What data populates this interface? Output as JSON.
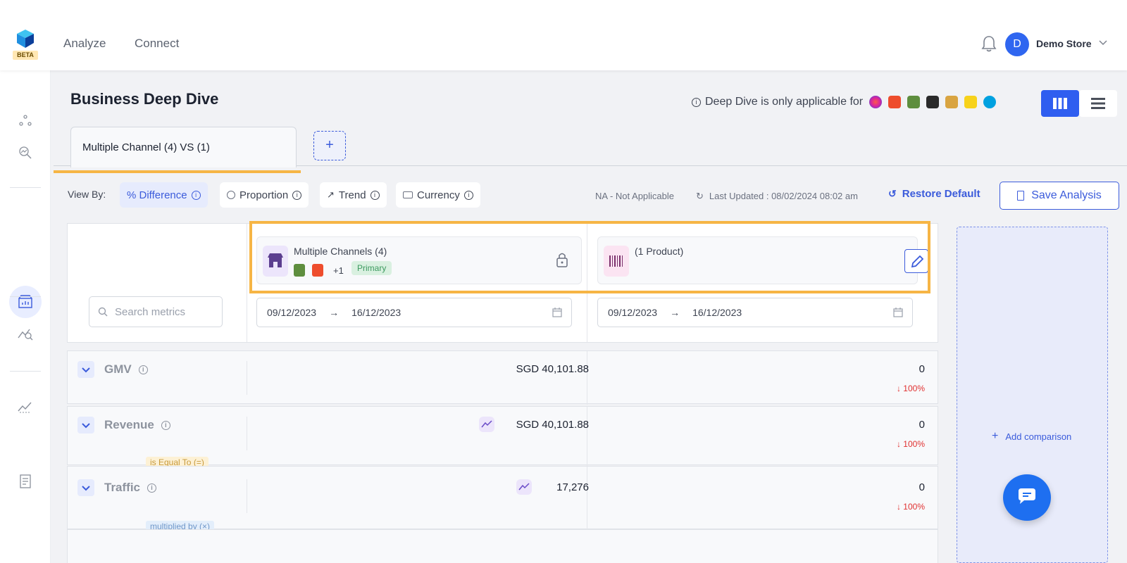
{
  "header": {
    "beta_label": "BETA",
    "nav": [
      "Analyze",
      "Connect"
    ],
    "avatar_initial": "D",
    "store_name": "Demo Store"
  },
  "page": {
    "title": "Business Deep Dive",
    "deep_dive_note": "Deep Dive is only applicable for",
    "channel_icons": [
      "instagram-ads-icon",
      "shopee-icon",
      "shopify-icon",
      "tiktok-icon",
      "marketplace-box-icon",
      "flipkart-icon",
      "salesforce-icon"
    ]
  },
  "tabs": {
    "active_label": "Multiple Channel (4) VS (1)",
    "add_label": "+"
  },
  "toolbar": {
    "view_by_label": "View By:",
    "options": [
      "% Difference",
      "Proportion",
      "Trend",
      "Currency"
    ],
    "na_note": "NA - Not Applicable",
    "last_updated": "Last Updated : 08/02/2024 08:02 am",
    "restore_label": "Restore Default",
    "save_label": "Save Analysis"
  },
  "search": {
    "placeholder": "Search metrics"
  },
  "columns": [
    {
      "name": "Multiple Channels (4)",
      "extra_count": "+1",
      "badge": "Primary",
      "date_from": "09/12/2023",
      "date_to": "16/12/2023"
    },
    {
      "name": "(1 Product)",
      "date_from": "09/12/2023",
      "date_to": "16/12/2023"
    }
  ],
  "metrics": [
    {
      "name": "GMV",
      "value_a": "SGD 40,101.88",
      "value_b": "0",
      "change": "100%"
    },
    {
      "name": "Revenue",
      "value_a": "SGD 40,101.88",
      "value_b": "0",
      "change": "100%"
    },
    {
      "name": "Traffic",
      "value_a": "17,276",
      "value_b": "0",
      "change": "100%"
    }
  ],
  "operators": [
    "is Equal To (=)",
    "multiplied by (×)"
  ],
  "comparison": {
    "add_label": "Add comparison"
  },
  "colors": {
    "accent": "#3b5bdb",
    "highlight": "#f6b545",
    "negative": "#e03131",
    "primary_badge": "#d9f0e0"
  }
}
